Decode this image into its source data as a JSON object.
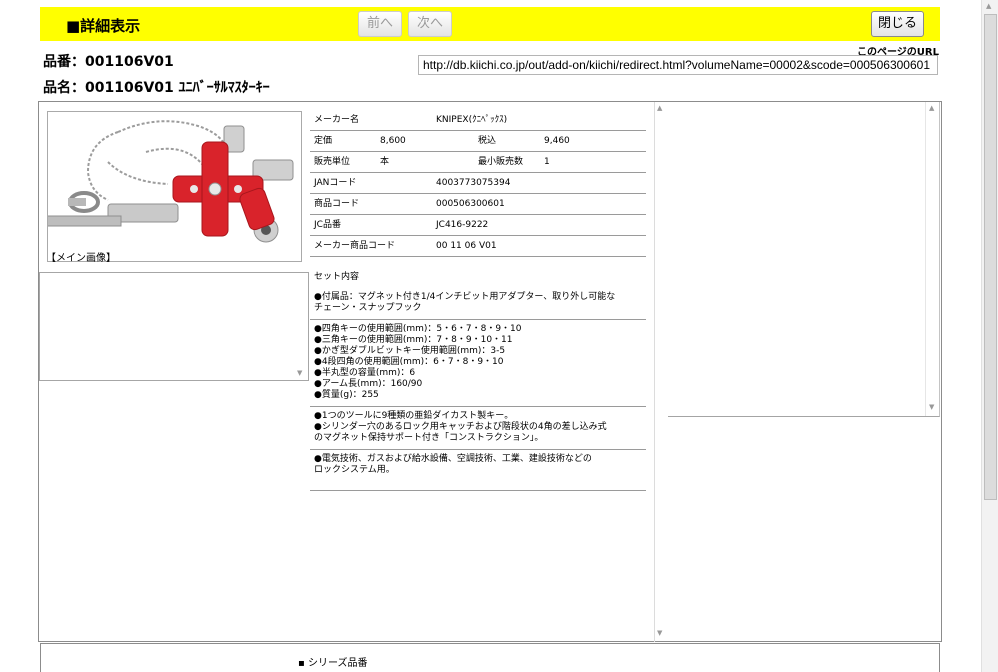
{
  "header": {
    "title": "■詳細表示",
    "prev_label": "前へ",
    "next_label": "次へ",
    "close_label": "閉じる"
  },
  "product": {
    "hinban": "品番：001106V01",
    "hinmei": "品名：001106V01 ﾕﾆﾊﾞｰｻﾙﾏｽﾀｰｷｰ"
  },
  "page_url": {
    "label": "このページのURL",
    "value": "http://db.kiichi.co.jp/out/add-on/kiichi/redirect.html?volumeName=00002&scode=000506300601"
  },
  "image": {
    "caption": "【メイン画像】",
    "icon": "master-key-product-photo",
    "accent_color": "#d9232b"
  },
  "spec": {
    "maker_label": "メーカー名",
    "maker_value": "KNIPEX(ｸﾆﾍﾟｯｸｽ)",
    "price_label": "定価",
    "price_value": "8,600",
    "taxin_label": "税込",
    "taxin_value": "9,460",
    "unit_label": "販売単位",
    "unit_value": "本",
    "minqty_label": "最小販売数",
    "minqty_value": "1",
    "jan_label": "JANコード",
    "jan_value": "4003773075394",
    "code_label": "商品コード",
    "code_value": "000506300601",
    "jc_label": "JC品番",
    "jc_value": "JC416-9222",
    "makercode_label": "メーカー商品コード",
    "makercode_value": "00 11 06 V01"
  },
  "notes": {
    "set_title": "セット内容",
    "set_lines": [
      "●付属品：マグネット付き1/4インチビット用アダプター、取り外し可能な",
      "チェーン・スナップフック"
    ],
    "spec_lines": [
      "●四角キーの使用範囲(mm)：5・6・7・8・9・10",
      "●三角キーの使用範囲(mm)：7・8・9・10・11",
      "●かぎ型ダブルビットキー使用範囲(mm)：3-5",
      "●4段四角の使用範囲(mm)：6・7・8・9・10",
      "●半丸型の容量(mm)：6",
      "●アーム長(mm)：160/90",
      "●質量(g)：255"
    ],
    "feature_lines": [
      "●1つのツールに9種類の亜鉛ダイカスト製キー。",
      "●シリンダー穴のあるロック用キャッチおよび階段状の4角の差し込み式",
      "のマグネット保持サポート付き「コンストラクション」。"
    ],
    "use_lines": [
      "●電気技術、ガスおよび給水設備、空調技術、工業、建設技術などの",
      "ロックシステム用。"
    ]
  },
  "bottom": {
    "series_label": "▪ シリーズ品番"
  }
}
